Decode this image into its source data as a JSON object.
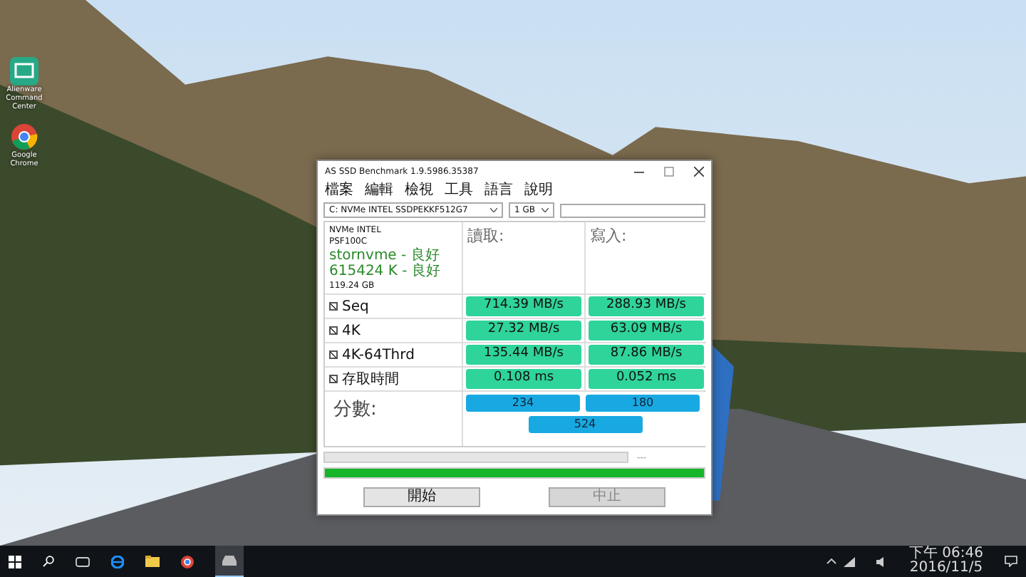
{
  "desktop_icons": [
    {
      "kind": "app",
      "label": "Alienware Command Center"
    },
    {
      "kind": "chrome",
      "label": "Google Chrome"
    }
  ],
  "window": {
    "title": "AS SSD Benchmark 1.9.5986.35387",
    "menu": [
      "檔案",
      "編輯",
      "檢視",
      "工具",
      "語言",
      "說明"
    ],
    "drive_select": "C: NVMe INTEL SSDPEKKF512G7",
    "size_select": "1 GB",
    "drive_info": [
      {
        "text": "NVMe INTEL",
        "ok": false
      },
      {
        "text": "PSF100C",
        "ok": false
      },
      {
        "text": "stornvme - 良好",
        "ok": true
      },
      {
        "text": "615424 K - 良好",
        "ok": true
      },
      {
        "text": "119.24 GB",
        "ok": false
      }
    ],
    "read_header": "讀取:",
    "write_header": "寫入:",
    "rows": [
      {
        "label": "Seq",
        "checked": true,
        "read": "714.39 MB/s",
        "write": "288.93 MB/s"
      },
      {
        "label": "4K",
        "checked": true,
        "read": "27.32 MB/s",
        "write": "63.09 MB/s"
      },
      {
        "label": "4K-64Thrd",
        "checked": true,
        "read": "135.44 MB/s",
        "write": "87.86 MB/s"
      },
      {
        "label": "存取時間",
        "checked": true,
        "read": "0.108 ms",
        "write": "0.052 ms"
      }
    ],
    "score_label": "分數:",
    "score_read": "234",
    "score_write": "180",
    "score_total": "524",
    "time_text": "---",
    "sub_progress": {
      "level": 0
    },
    "progress": {
      "level": 1
    },
    "buttons": [
      {
        "label": "開始",
        "disabled": false
      },
      {
        "label": "中止",
        "disabled": true
      }
    ]
  },
  "taskbar": {
    "clock_time": "下午 06:46",
    "clock_date": "2016/11/5"
  }
}
